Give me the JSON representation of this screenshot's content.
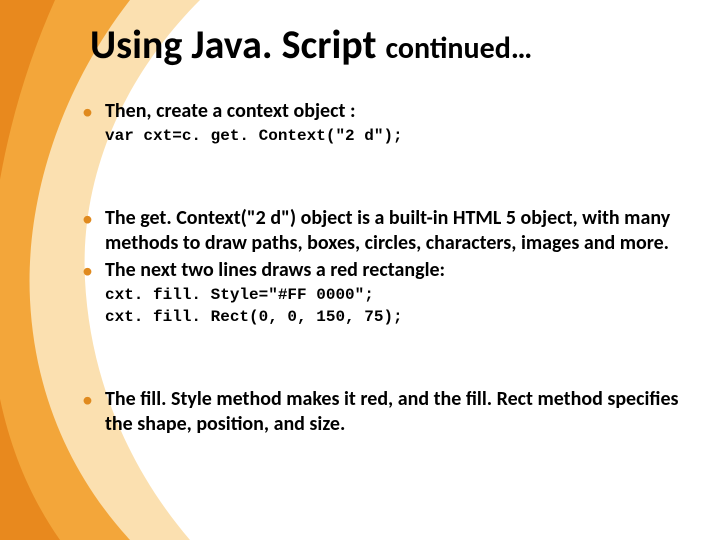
{
  "title": {
    "main": "Using Java. Script ",
    "sub": "continued…"
  },
  "bullets": {
    "b1": "Then, create a context object :",
    "code1": "var cxt=c. get. Context(\"2 d\");",
    "b2": "The get. Context(\"2 d\") object is a built-in HTML 5 object, with many methods to draw paths, boxes, circles, characters, images and more.",
    "b3": "The next two lines draws a red rectangle:",
    "code2a": "cxt. fill. Style=\"#FF 0000\";",
    "code2b": "cxt. fill. Rect(0, 0, 150, 75);",
    "b4": "The fill. Style method makes it red, and the fill. Rect method specifies the shape, position, and size."
  }
}
